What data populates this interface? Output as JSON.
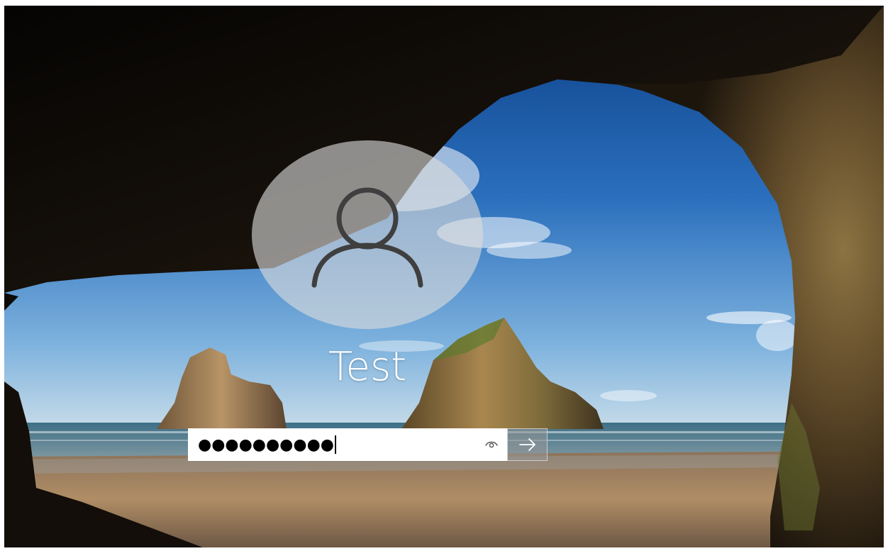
{
  "login": {
    "username": "Test",
    "password_masked": "●●●●●●●●●●"
  },
  "icons": {
    "avatar": "user-silhouette-icon",
    "reveal": "eye-icon",
    "submit": "arrow-right-icon"
  },
  "colors": {
    "field_background": "#ffffff",
    "submit_background": "#8f8f8f",
    "text": "#ffffff"
  }
}
